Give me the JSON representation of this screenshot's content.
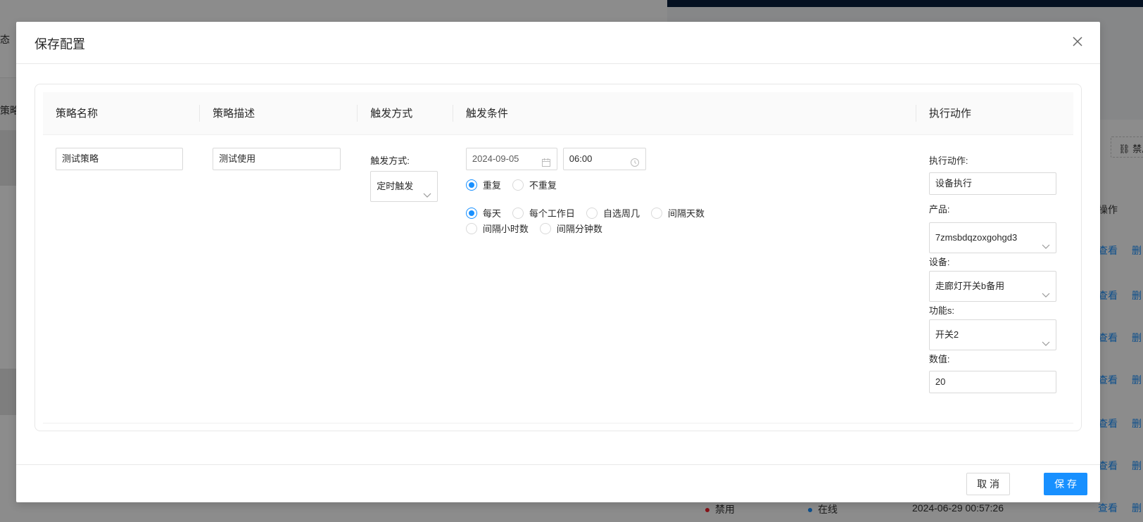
{
  "background": {
    "left_fragment_top": "态",
    "left_fragment_header": "策略",
    "right_button_fragment": "⛓ 禁用",
    "col_operation": "操作",
    "link_view": "查看",
    "link_delete": "删",
    "last_row": {
      "status": "禁用",
      "online": "在线",
      "timestamp": "2024-06-29 00:57:26"
    }
  },
  "modal": {
    "title": "保存配置",
    "columns": [
      "策略名称",
      "策略描述",
      "触发方式",
      "触发条件",
      "执行动作"
    ],
    "row": {
      "name_value": "测试策略",
      "desc_value": "测试使用",
      "trigger_type_label": "触发方式:",
      "trigger_type_value": "定时触发",
      "date_value": "2024-09-05",
      "time_value": "06:00",
      "repeat_options": [
        {
          "label": "重复",
          "checked": true
        },
        {
          "label": "不重复",
          "checked": false
        }
      ],
      "frequency_options": [
        {
          "label": "每天",
          "checked": true
        },
        {
          "label": "每个工作日",
          "checked": false
        },
        {
          "label": "自选周几",
          "checked": false
        },
        {
          "label": "间隔天数",
          "checked": false
        },
        {
          "label": "间隔小时数",
          "checked": false
        },
        {
          "label": "间隔分钟数",
          "checked": false
        }
      ],
      "action_label": "执行动作:",
      "action_value": "设备执行",
      "product_label": "产品:",
      "product_value": "7zmsbdqzoxgohgd3",
      "device_label": "设备:",
      "device_value": "走廊灯开关b备用",
      "function_label": "功能s:",
      "function_value": "开关2",
      "number_label": "数值:",
      "number_value": "20"
    },
    "footer": {
      "cancel_label": "取 消",
      "save_label": "保 存"
    }
  },
  "colors": {
    "primary": "#1890ff",
    "mask": "rgba(0,0,0,0.45)"
  }
}
